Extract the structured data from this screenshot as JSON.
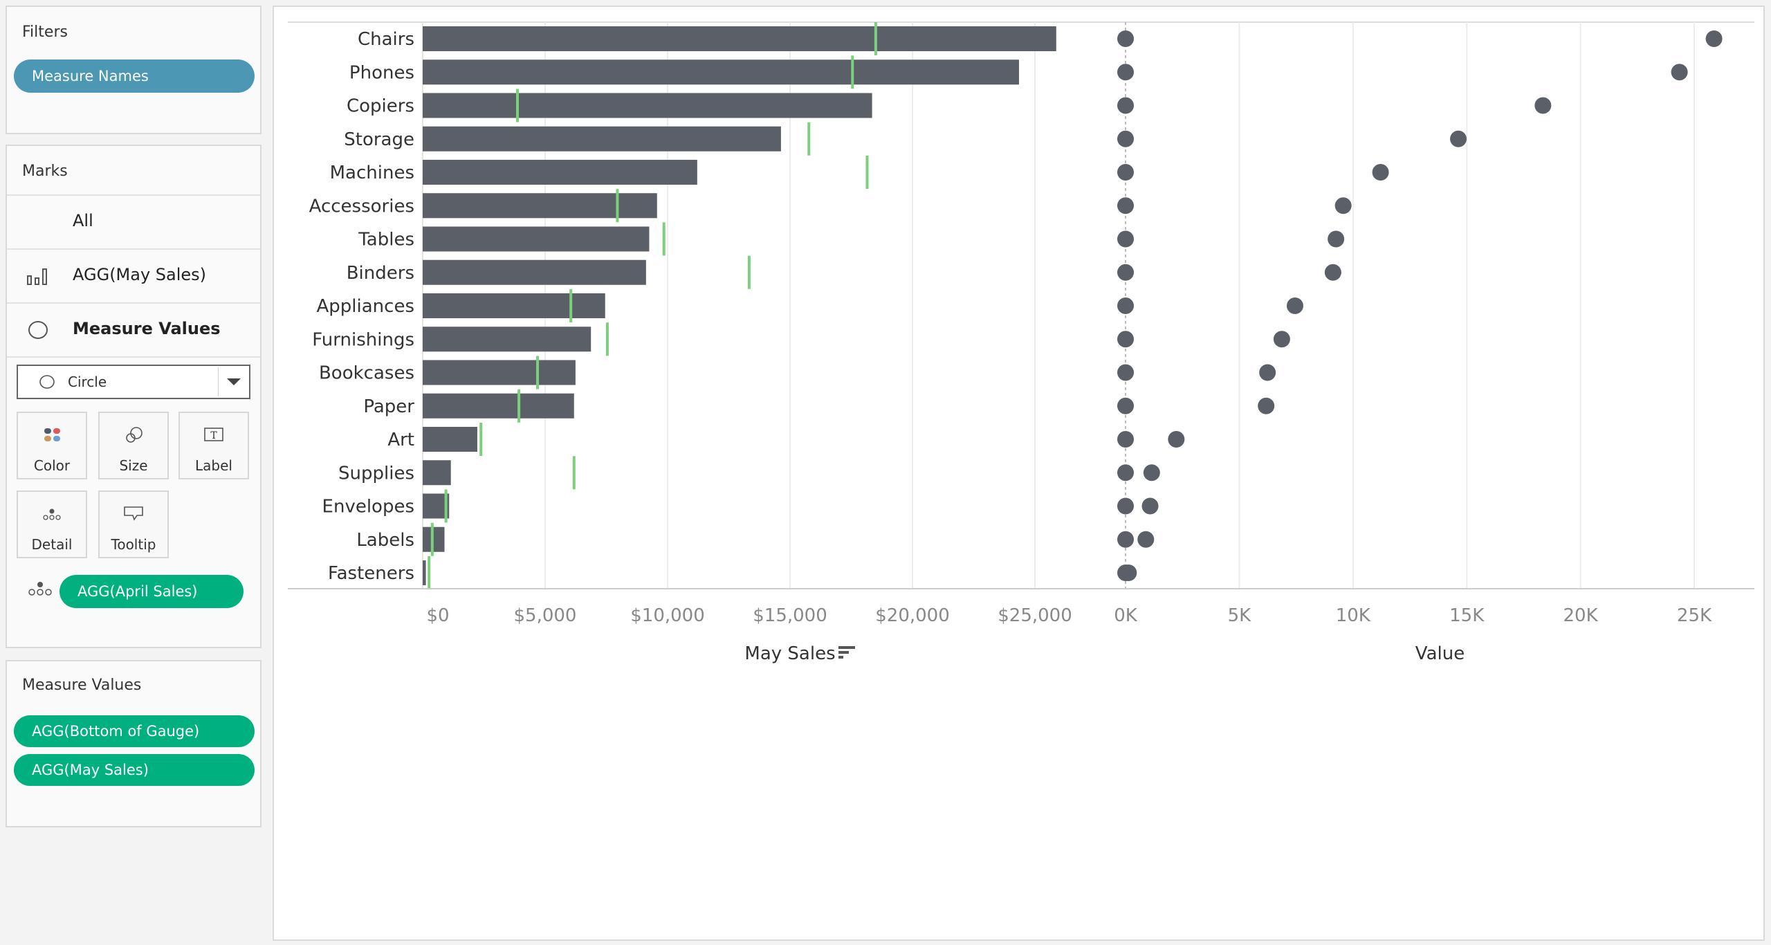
{
  "filters": {
    "title": "Filters",
    "pills": [
      "Measure Names"
    ]
  },
  "marks": {
    "title": "Marks",
    "rows": [
      {
        "label": "All",
        "icon": "none"
      },
      {
        "label": "AGG(May Sales)",
        "icon": "bar-chart-icon"
      },
      {
        "label": "Measure Values",
        "icon": "circle-icon"
      }
    ],
    "mark_type": {
      "selected": "Circle",
      "icon": "circle-icon"
    },
    "buttons": [
      "Color",
      "Size",
      "Label",
      "Detail",
      "Tooltip"
    ],
    "detail_pill": "AGG(April Sales)"
  },
  "measure_values": {
    "title": "Measure Values",
    "pills": [
      "AGG(Bottom of Gauge)",
      "AGG(May Sales)"
    ]
  },
  "colors": {
    "bar": "#5b5f67",
    "april_tick": "#7ccf7c",
    "dot": "#5b5f67",
    "filter_pill": "#4b97b4",
    "measure_pill": "#00b07f"
  },
  "chart_data": [
    {
      "type": "bar",
      "xlabel": "May Sales",
      "sort_icon": "sort-descending-icon",
      "categories": [
        "Chairs",
        "Phones",
        "Copiers",
        "Storage",
        "Machines",
        "Accessories",
        "Tables",
        "Binders",
        "Appliances",
        "Furnishings",
        "Bookcases",
        "Paper",
        "Art",
        "Supplies",
        "Envelopes",
        "Labels",
        "Fasteners"
      ],
      "series": [
        {
          "name": "AGG(May Sales)",
          "mark": "bar",
          "values": [
            25870,
            24350,
            18350,
            14630,
            11210,
            9570,
            9250,
            9120,
            7450,
            6870,
            6240,
            6180,
            2230,
            1150,
            1080,
            890,
            130
          ]
        },
        {
          "name": "AGG(April Sales)",
          "mark": "reference-tick",
          "values": [
            18500,
            17550,
            3870,
            15770,
            18150,
            7950,
            9850,
            13330,
            6050,
            7540,
            4690,
            3930,
            2380,
            6180,
            950,
            390,
            260
          ]
        }
      ],
      "xlim": [
        0,
        27000
      ],
      "xticks": [
        0,
        5000,
        10000,
        15000,
        20000,
        25000
      ],
      "xtick_labels": [
        "$0",
        "$5,000",
        "$10,000",
        "$15,000",
        "$20,000",
        "$25,000"
      ],
      "grid": true
    },
    {
      "type": "scatter",
      "xlabel": "Value",
      "categories": [
        "Chairs",
        "Phones",
        "Copiers",
        "Storage",
        "Machines",
        "Accessories",
        "Tables",
        "Binders",
        "Appliances",
        "Furnishings",
        "Bookcases",
        "Paper",
        "Art",
        "Supplies",
        "Envelopes",
        "Labels",
        "Fasteners"
      ],
      "series": [
        {
          "name": "AGG(Bottom of Gauge)",
          "values": [
            0,
            0,
            0,
            0,
            0,
            0,
            0,
            0,
            0,
            0,
            0,
            0,
            0,
            0,
            0,
            0,
            0
          ]
        },
        {
          "name": "AGG(May Sales)",
          "values": [
            25870,
            24350,
            18350,
            14630,
            11210,
            9570,
            9250,
            9120,
            7450,
            6870,
            6240,
            6180,
            2230,
            1150,
            1080,
            890,
            130
          ]
        }
      ],
      "xlim": [
        0,
        27700
      ],
      "xticks": [
        0,
        5000,
        10000,
        15000,
        20000,
        25000
      ],
      "xtick_labels": [
        "0K",
        "5K",
        "10K",
        "15K",
        "20K",
        "25K"
      ],
      "grid": true
    }
  ]
}
